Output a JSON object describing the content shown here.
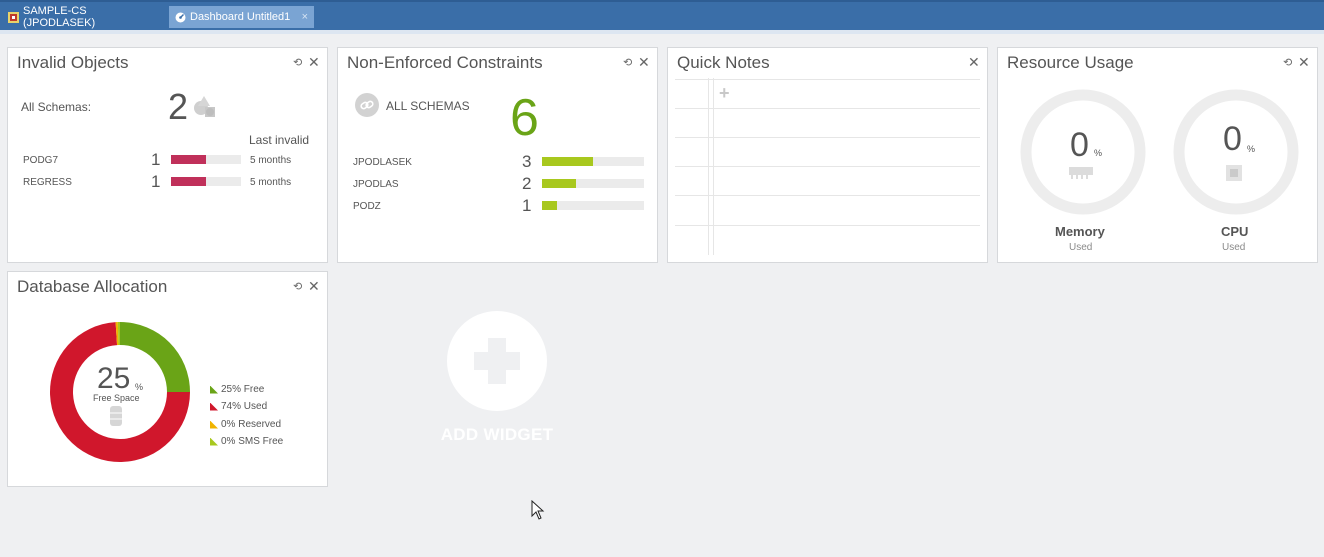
{
  "tabs": [
    {
      "label": "SAMPLE-CS (JPODLASEK)"
    },
    {
      "label": "Dashboard Untitled1",
      "close": "×"
    }
  ],
  "invalid_objects": {
    "title": "Invalid Objects",
    "all_schemas_label": "All Schemas:",
    "total": "2",
    "last_invalid_label": "Last invalid",
    "rows": [
      {
        "schema": "PODG7",
        "count": "1",
        "fill": 0.5,
        "when": "5 months"
      },
      {
        "schema": "REGRESS",
        "count": "1",
        "fill": 0.5,
        "when": "5 months"
      }
    ],
    "bar_color": "#c0305a"
  },
  "constraints": {
    "title": "Non-Enforced Constraints",
    "all_schemas_label": "ALL SCHEMAS",
    "total": "6",
    "rows": [
      {
        "schema": "JPODLASEK",
        "count": "3",
        "fill": 0.5
      },
      {
        "schema": "JPODLAS",
        "count": "2",
        "fill": 0.33
      },
      {
        "schema": "PODZ",
        "count": "1",
        "fill": 0.15
      }
    ],
    "bar_color": "#a8c81e",
    "accent": "#6aa417"
  },
  "quick_notes": {
    "title": "Quick Notes",
    "add_glyph": "+"
  },
  "resource_usage": {
    "title": "Resource Usage",
    "memory": {
      "value": "0",
      "unit": "%",
      "label": "Memory",
      "sub": "Used"
    },
    "cpu": {
      "value": "0",
      "unit": "%",
      "label": "CPU",
      "sub": "Used"
    }
  },
  "db_allocation": {
    "title": "Database Allocation",
    "center_value": "25",
    "center_unit": "%",
    "center_label": "Free Space",
    "legend": [
      {
        "label": "25% Free",
        "color": "#6aa417"
      },
      {
        "label": "74% Used",
        "color": "#d0172c"
      },
      {
        "label": "0% Reserved",
        "color": "#f0b400"
      },
      {
        "label": "0% SMS Free",
        "color": "#a8c81e"
      }
    ],
    "slices": [
      {
        "name": "Free",
        "value": 25,
        "color": "#6aa417"
      },
      {
        "name": "Used",
        "value": 74,
        "color": "#d0172c"
      },
      {
        "name": "Reserved",
        "value": 0.5,
        "color": "#f0b400"
      },
      {
        "name": "SMS Free",
        "value": 0.5,
        "color": "#a8c81e"
      }
    ]
  },
  "add_widget": {
    "label": "ADD WIDGET"
  },
  "controls": {
    "refresh": "⟲",
    "close": "✕"
  }
}
